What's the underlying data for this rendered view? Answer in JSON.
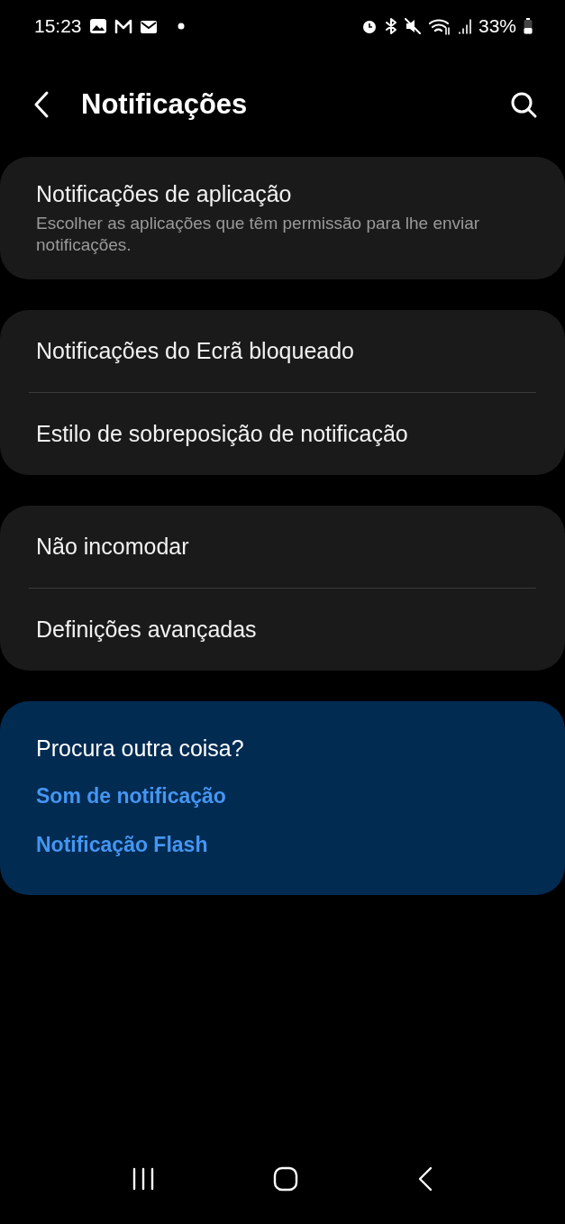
{
  "status_bar": {
    "time": "15:23",
    "battery": "33%"
  },
  "header": {
    "title": "Notificações"
  },
  "groups": [
    {
      "items": [
        {
          "title": "Notificações de aplicação",
          "subtitle": "Escolher as aplicações que têm permissão para lhe enviar notificações."
        }
      ]
    },
    {
      "items": [
        {
          "title": "Notificações do Ecrã bloqueado"
        },
        {
          "title": "Estilo de sobreposição de notificação"
        }
      ]
    },
    {
      "items": [
        {
          "title": "Não incomodar"
        },
        {
          "title": "Definições avançadas"
        }
      ]
    }
  ],
  "related": {
    "title": "Procura outra coisa?",
    "links": [
      "Som de notificação",
      "Notificação Flash"
    ]
  }
}
